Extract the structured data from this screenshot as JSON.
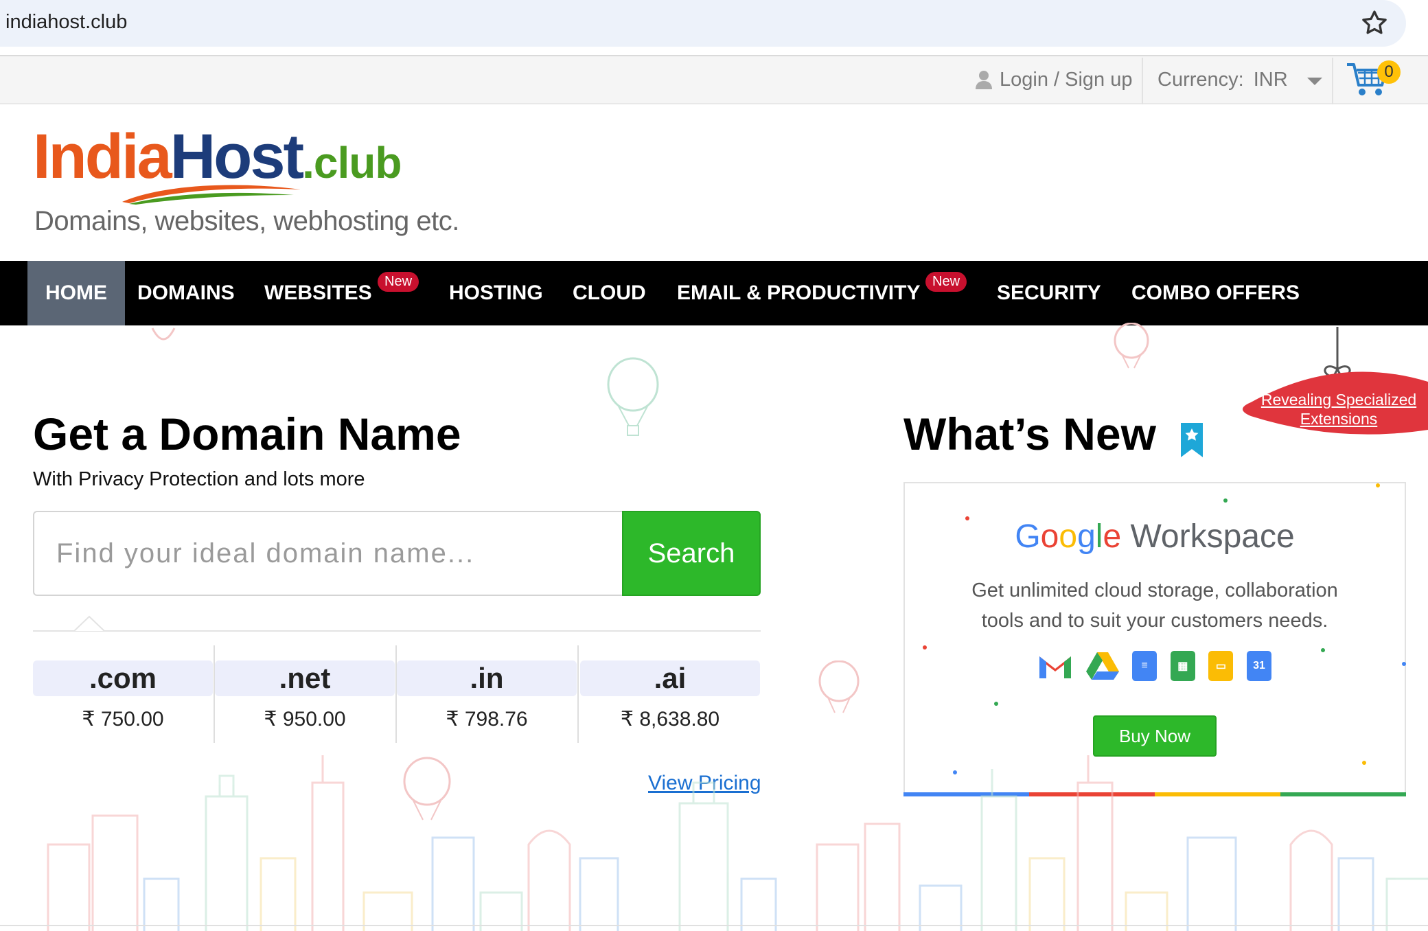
{
  "browser": {
    "url": "indiahost.club",
    "bookmark_icon": "star-outline-icon"
  },
  "topbar": {
    "login_label": "Login / Sign up",
    "currency_label": "Currency:",
    "currency_value": "INR",
    "cart_count": "0"
  },
  "logo": {
    "india": "India",
    "host": "Host",
    "club": ".club",
    "tagline": "Domains, websites, webhosting etc."
  },
  "nav": {
    "items": [
      {
        "label": "HOME",
        "active": true
      },
      {
        "label": "DOMAINS"
      },
      {
        "label": "WEBSITES",
        "badge": "New"
      },
      {
        "label": "HOSTING"
      },
      {
        "label": "CLOUD"
      },
      {
        "label": "EMAIL & PRODUCTIVITY",
        "badge": "New"
      },
      {
        "label": "SECURITY"
      },
      {
        "label": "COMBO OFFERS"
      }
    ]
  },
  "domain": {
    "title": "Get a Domain Name",
    "subtitle": "With Privacy Protection and lots more",
    "search_placeholder": "Find your ideal domain name...",
    "search_button": "Search",
    "tlds": [
      {
        "name": ".com",
        "price": "₹ 750.00"
      },
      {
        "name": ".net",
        "price": "₹ 950.00"
      },
      {
        "name": ".in",
        "price": "₹ 798.76"
      },
      {
        "name": ".ai",
        "price": "₹ 8,638.80"
      }
    ],
    "view_pricing": "View Pricing"
  },
  "whats_new": {
    "title": "What’s New",
    "promo_line1": "Revealing Specialized",
    "promo_line2": "Extensions",
    "product_google": "Google",
    "product_name": "Workspace",
    "description_line1": "Get unlimited cloud storage, collaboration",
    "description_line2": "tools and to suit your customers needs.",
    "buy_button": "Buy Now",
    "app_icons": [
      "gmail-icon",
      "drive-icon",
      "docs-icon",
      "sheets-icon",
      "slides-icon",
      "calendar-icon"
    ],
    "calendar_day": "31"
  },
  "colors": {
    "nav_bg": "#000000",
    "nav_active": "#5b6675",
    "accent_green": "#2db82a",
    "badge_red": "#c8102e",
    "link_blue": "#1a6fd1"
  }
}
